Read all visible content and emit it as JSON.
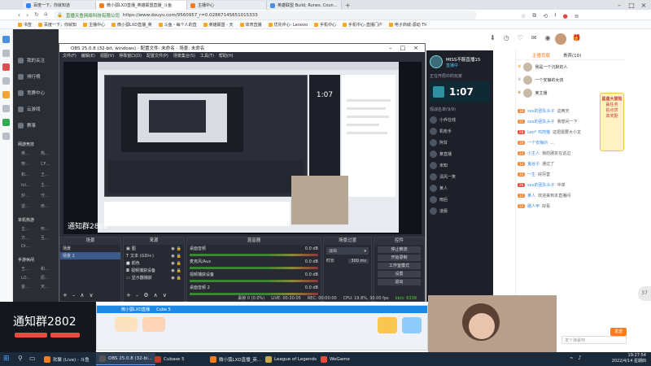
{
  "browser": {
    "tabs": [
      {
        "label": "百度一下，你就知道",
        "color": "#3b82f6"
      },
      {
        "label": "微小弧LXD直播_英雄联盟直播_斗鱼",
        "color": "#f57c1f",
        "active": true
      },
      {
        "label": "主播中心",
        "color": "#f57c1f"
      },
      {
        "label": "英雄联盟 Build, Runes, Counters",
        "color": "#4a90e2"
      }
    ],
    "url_site": "直播天鱼网络科技有限公司",
    "url": "https://www.douyu.com/9560957_r=0.02867145651015333",
    "bookmarks": [
      "书签",
      "百度一下，你就知",
      "主播中心",
      "微小弧LXD直播_英",
      "斗鱼 - 每个人的直",
      "英雄联盟 - 天",
      "体育直播",
      "优先中心- Lenovo",
      "手机中心",
      "手机中心-直播门户",
      "电子商城-源动 Th"
    ]
  },
  "douyu_sidebar": {
    "items": [
      "我的关注",
      "排行榜",
      "竞赛中心",
      "云游戏",
      "赛事"
    ],
    "sections": [
      {
        "title": "网游竞技",
        "items": [
          "英雄联盟",
          "热门游戏",
          "穿越火线",
          "CF手游",
          "和平精英",
          "王者荣耀",
          "lol云顶之弈",
          "主机游戏",
          "炉石传说",
          "守望先锋",
          "逆战手游",
          "命运方舟"
        ]
      },
      {
        "title": "单机热游",
        "items": [
          "主机游戏",
          "怀旧游戏",
          "方舟掉落",
          "互动游戏",
          "Dread"
        ]
      },
      {
        "title": "手游休闲",
        "items": [
          "王者荣耀",
          "和平精英",
          "LOL手游",
          "原神手游",
          "金铲铲之战",
          "天涯明月刀"
        ]
      }
    ]
  },
  "obs": {
    "title": "OBS 25.0.8 (32-bit, windows) - 配置文件: 未命名 - 场景: 未命名",
    "menu": [
      "文件(F)",
      "编辑(E)",
      "视图(V)",
      "停靠窗口(D)",
      "配置文件(P)",
      "场景集合(S)",
      "工具(T)",
      "帮助(H)"
    ],
    "docks": {
      "scenes": {
        "title": "场景",
        "items": [
          "场景",
          "场景 2"
        ]
      },
      "sources": {
        "title": "来源",
        "items": [
          "图",
          "文本 (GDI+)",
          "颜色",
          "视频捕获设备",
          "显示器捕获"
        ]
      },
      "mixer": {
        "title": "混音器",
        "channels": [
          {
            "name": "桌面音频",
            "db": "0.0 dB"
          },
          {
            "name": "麦克风/Aux",
            "db": "0.0 dB"
          },
          {
            "name": "视频捕获设备",
            "db": "0.0 dB"
          },
          {
            "name": "桌面音频 2",
            "db": "0.0 dB"
          }
        ]
      },
      "transitions": {
        "title": "场景过渡",
        "type": "淡出",
        "duration_label": "时长",
        "duration": "300 ms"
      },
      "controls": {
        "title": "控件",
        "buttons": [
          "停止推流",
          "开始录制",
          "工作室模式",
          "设置",
          "退出"
        ]
      }
    },
    "status": [
      "丢帧 0 (0.0%)",
      "LIVE: 00:30:05",
      "REC: 00:00:00",
      "CPU: 19.8%, 30.00 fps",
      "kb/s: 6338"
    ]
  },
  "streampanel": {
    "name": "MISS不服直播15",
    "sub": "直播中",
    "game_time": "1:07",
    "section1": "正在开局中的玩家",
    "section2": "观战名单(9/9)",
    "players": [
      "小乔在线",
      "机枪手",
      "阿甘",
      "某直播",
      "未知",
      "清风一笑",
      "某人",
      "雨后",
      "凌晨"
    ]
  },
  "chat": {
    "tabs": [
      "主播贡献",
      "贵宾(10)"
    ],
    "ranks": [
      "我是一个沉默的人",
      "一个安静的女孩",
      "某主播"
    ],
    "promo": [
      "星座大冒险",
      "赢任务",
      "拍点赏",
      "高奖励"
    ],
    "messages": [
      {
        "lvl": "18",
        "nick": "sxx的团队头子",
        "text": "这两天"
      },
      {
        "lvl": "21",
        "nick": "sxx的团队头子",
        "text": "我想问一下"
      },
      {
        "lvl": "28",
        "nick": "Leo* 鸡肉猫",
        "text": "这把需要大小龙"
      },
      {
        "lvl": "19",
        "nick": "一个安静的",
        "text": "..."
      },
      {
        "lvl": "23",
        "nick": "小主人",
        "text": "我的朋友在这边"
      },
      {
        "lvl": "12",
        "nick": "鬼谷子",
        "text": "通过了"
      },
      {
        "lvl": "15",
        "nick": "一生",
        "text": "好厉害"
      },
      {
        "lvl": "26",
        "nick": "sxx的团队头子",
        "text": "中单"
      },
      {
        "lvl": "17",
        "nick": "某人",
        "text": "欢迎来到本直播间"
      },
      {
        "lvl": "22",
        "nick": "路人甲",
        "text": "好看"
      }
    ],
    "input_placeholder": "发个弹幕吧",
    "send": "发送"
  },
  "bottom": {
    "overlay_text": "通知群2802",
    "live_title": "微小弧LXD直播",
    "cube_label": "Cube 5"
  },
  "taskbar": {
    "apps": [
      {
        "label": "欢聚 (Live) - 斗鱼",
        "color": "#f57c1f"
      },
      {
        "label": "OBS 25.0.8 (32-bi...",
        "color": "#555555",
        "active": true
      },
      {
        "label": "Cubase 5",
        "color": "#c0392b"
      },
      {
        "label": "微小弧LXD直播_英...",
        "color": "#f57c1f"
      },
      {
        "label": "League of Legends",
        "color": "#c8a74a"
      },
      {
        "label": "WeGame",
        "color": "#e84b3c"
      }
    ],
    "time": "19:27:54",
    "date": "2022/4/14 星期四"
  }
}
